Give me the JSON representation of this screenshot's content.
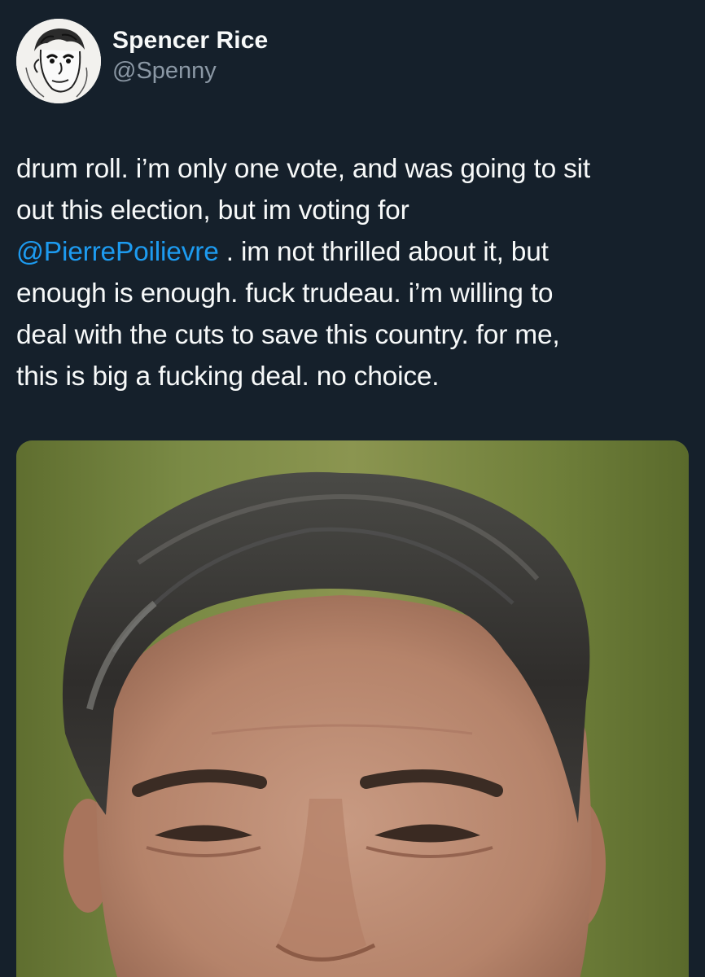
{
  "author": {
    "display_name": "Spencer Rice",
    "handle": "@Spenny",
    "avatar_icon": "cartoon-avatar"
  },
  "tweet": {
    "lines": [
      "drum roll.  i’m only one vote, and was going to sit",
      "out this election, but im voting for",
      "enough is enough.  fuck trudeau.  i’m willing to",
      "deal with the cuts to save this country.  for me,",
      "this is big a fucking deal.  no choice."
    ],
    "mention": "@PierrePoilievre",
    "after_mention": " . im not thrilled about it, but"
  },
  "media": {
    "type": "photo"
  },
  "colors": {
    "background": "#15202b",
    "text": "#f7f9f9",
    "secondary": "#8b98a5",
    "link": "#1d9bf0"
  }
}
